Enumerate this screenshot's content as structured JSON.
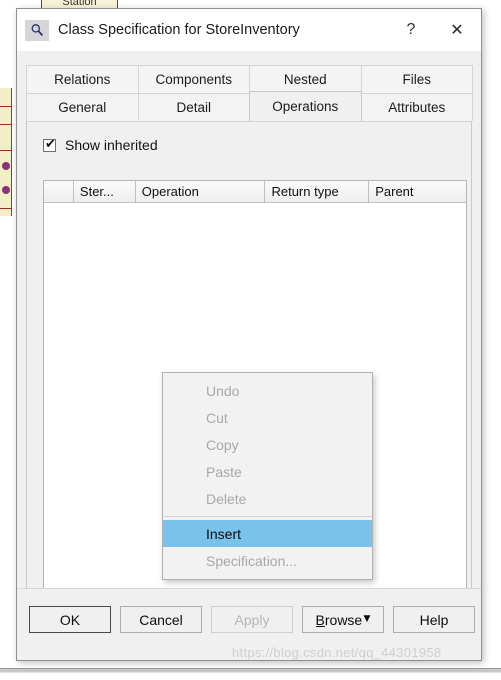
{
  "background": {
    "station_label": "Station"
  },
  "window": {
    "title": "Class Specification for StoreInventory",
    "icon": "magnifier-icon",
    "help_button": "?",
    "close_button": "✕"
  },
  "tabs": {
    "row1": [
      {
        "label": "Relations",
        "selected": false
      },
      {
        "label": "Components",
        "selected": false
      },
      {
        "label": "Nested",
        "selected": false
      },
      {
        "label": "Files",
        "selected": false
      }
    ],
    "row2": [
      {
        "label": "General",
        "selected": false
      },
      {
        "label": "Detail",
        "selected": false
      },
      {
        "label": "Operations",
        "selected": true
      },
      {
        "label": "Attributes",
        "selected": false
      }
    ]
  },
  "panel": {
    "show_inherited": {
      "label": "Show inherited",
      "checked": true,
      "tick": "✔"
    },
    "table": {
      "columns": [
        "",
        "Ster...",
        "Operation",
        "Return type",
        "Parent"
      ],
      "rows": []
    },
    "scrollbar": {
      "left_arrow": "❮",
      "right_arrow": "❯"
    }
  },
  "context_menu": {
    "items": [
      {
        "label": "Undo",
        "enabled": false,
        "highlighted": false
      },
      {
        "label": "Cut",
        "enabled": false,
        "highlighted": false
      },
      {
        "label": "Copy",
        "enabled": false,
        "highlighted": false
      },
      {
        "label": "Paste",
        "enabled": false,
        "highlighted": false
      },
      {
        "label": "Delete",
        "enabled": false,
        "highlighted": false
      },
      {
        "separator": true
      },
      {
        "label": "Insert",
        "enabled": true,
        "highlighted": true
      },
      {
        "label": "Specification...",
        "enabled": false,
        "highlighted": false
      }
    ],
    "highlight_color": "#79c2ea"
  },
  "footer": {
    "buttons": [
      {
        "label": "OK",
        "state": "default"
      },
      {
        "label": "Cancel",
        "state": "normal"
      },
      {
        "label": "Apply",
        "state": "disabled"
      },
      {
        "label": "Browse",
        "state": "split",
        "accesskey": "B",
        "arrow": "▼"
      },
      {
        "label": "Help",
        "state": "normal"
      }
    ]
  },
  "watermark": {
    "text": "https://blog.csdn.net/qq_44301958"
  }
}
